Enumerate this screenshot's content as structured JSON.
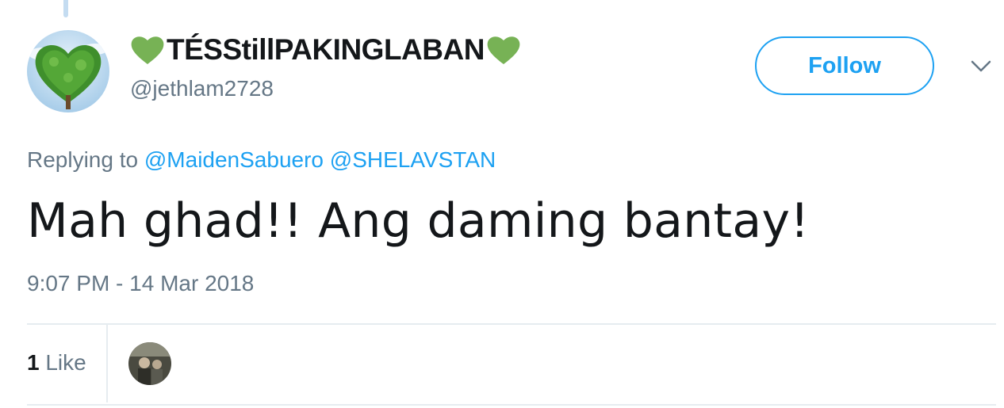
{
  "tweet": {
    "display_name": "TÉSStillPAKINGLABAN",
    "handle": "@jethlam2728",
    "name_prefix_icon": "green-heart-icon",
    "name_suffix_icon": "green-heart-icon",
    "follow_label": "Follow",
    "menu_icon": "chevron-down-icon",
    "replying_prefix": "Replying to",
    "replying_to": [
      "@MaidenSabuero",
      "@SHELAVSTAN"
    ],
    "text": "Mah ghad!! Ang daming bantay!",
    "timestamp": "9:07 PM - 14 Mar 2018",
    "likes_count": "1",
    "likes_label": "Like"
  },
  "colors": {
    "accent": "#1da1f2",
    "muted": "#657786",
    "divider": "#e6ecf0",
    "heart": "#77b255"
  }
}
